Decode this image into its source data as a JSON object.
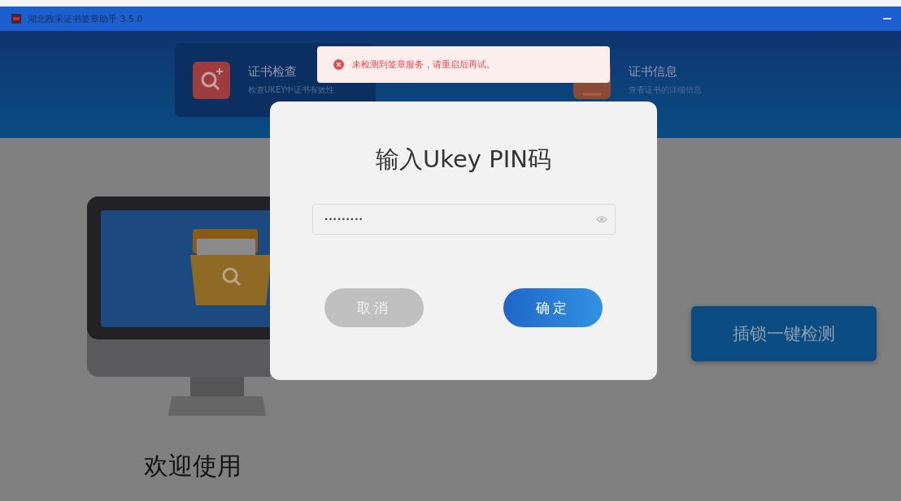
{
  "window": {
    "title": "湖北政采证书签章助手 3.5.0"
  },
  "feature_cards": [
    {
      "kind": "check",
      "title": "证书检查",
      "subtitle": "检查UKEY中证书有效性"
    },
    {
      "kind": "info",
      "title": "证书信息",
      "subtitle": "查看证书的详细信息"
    }
  ],
  "detect_button": "插锁一键检测",
  "welcome": "欢迎使用",
  "toast": {
    "kind": "error",
    "message": "未检测到签章服务，请重启后再试。"
  },
  "dialog": {
    "title": "输入Ukey PIN码",
    "pin_value": "•••••••••",
    "buttons": [
      {
        "kind": "cancel",
        "label": "取消"
      },
      {
        "kind": "confirm",
        "label": "确定"
      }
    ]
  }
}
